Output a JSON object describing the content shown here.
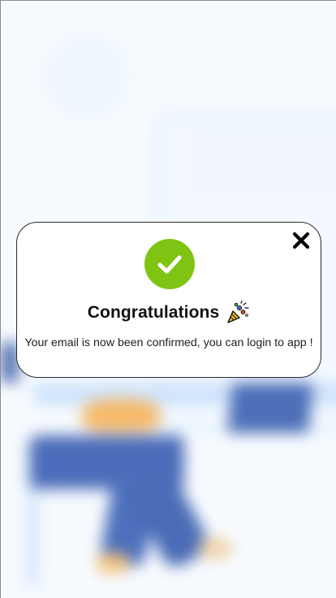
{
  "modal": {
    "title": "Congratulations",
    "message": "Your email is now been confirmed, you can login to app !",
    "icons": {
      "status": "check-circle-icon",
      "celebration": "party-popper-icon",
      "close": "close-icon"
    }
  },
  "colors": {
    "success": "#7fc412",
    "text": "#111111",
    "modal_border": "#2a2a2a"
  }
}
